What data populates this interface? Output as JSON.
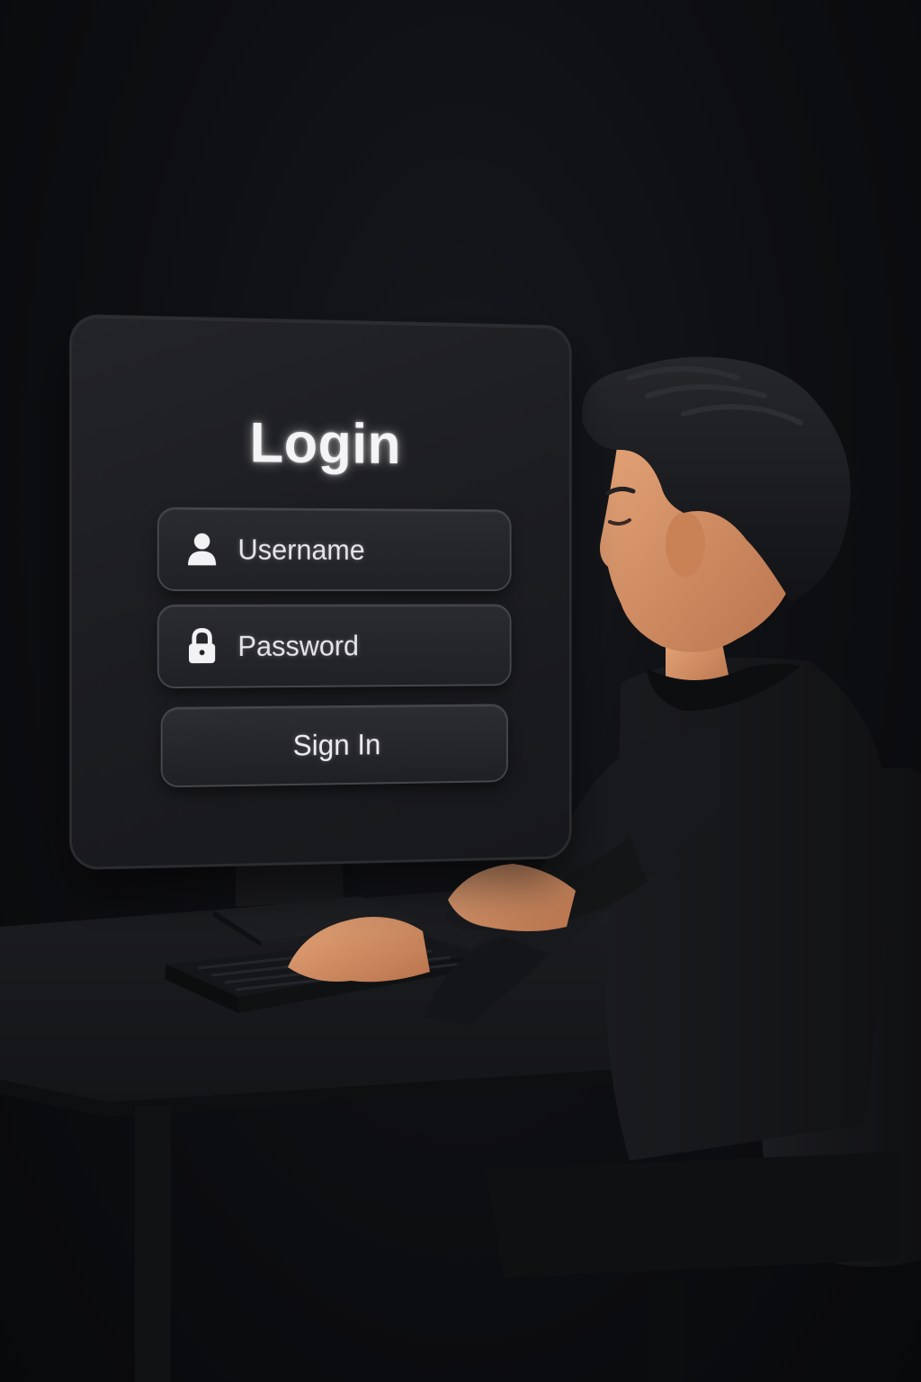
{
  "login_form": {
    "title": "Login",
    "username": {
      "placeholder": "Username",
      "icon": "user-icon"
    },
    "password": {
      "placeholder": "Password",
      "icon": "lock-icon"
    },
    "submit_label": "Sign In"
  },
  "colors": {
    "background": "#0b0c0f",
    "screen": "#1c1d20",
    "field": "#242529",
    "field_border": "#46474c",
    "text": "#f4f4f6",
    "skin": "#d9956b",
    "clothing": "#141517"
  }
}
